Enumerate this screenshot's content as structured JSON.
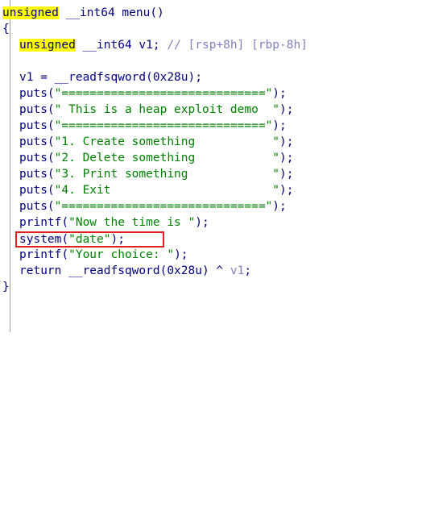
{
  "code": {
    "signature": {
      "kw": "unsigned",
      "rest": " __int64 menu()"
    },
    "open_brace": "{",
    "decl": {
      "kw": "unsigned",
      "rest": " __int64 v1; ",
      "comment": "// [rsp+8h] [rbp-8h]"
    },
    "line_v1": "v1 = __readfsqword(0x28u);",
    "puts_lines": [
      {
        "fn": "puts(",
        "str": "\"=============================\"",
        "end": ");"
      },
      {
        "fn": "puts(",
        "str": "\" This is a heap exploit demo  \"",
        "end": ");"
      },
      {
        "fn": "puts(",
        "str": "\"=============================\"",
        "end": ");"
      },
      {
        "fn": "puts(",
        "str": "\"1. Create something           \"",
        "end": ");"
      },
      {
        "fn": "puts(",
        "str": "\"2. Delete something           \"",
        "end": ");"
      },
      {
        "fn": "puts(",
        "str": "\"3. Print something            \"",
        "end": ");"
      },
      {
        "fn": "puts(",
        "str": "\"4. Exit                       \"",
        "end": ");"
      },
      {
        "fn": "puts(",
        "str": "\"=============================\"",
        "end": ");"
      }
    ],
    "printf_time": {
      "fn": "printf(",
      "str": "\"Now the time is \"",
      "end": ");"
    },
    "system_call": {
      "fn": "system(",
      "str": "\"date\"",
      "end": ");"
    },
    "printf_choice": {
      "fn": "printf(",
      "str": "\"Your choice: \"",
      "end": ");"
    },
    "return_line": {
      "pre": "return __readfsqword(0x28u) ^ ",
      "var": "v1",
      "end": ";"
    },
    "close_brace": "}"
  },
  "colors": {
    "keyword_highlight": "#ffff00",
    "code_text": "#000080",
    "string_literal": "#008000",
    "comment": "#8080c0",
    "annotation_box": "#e02020"
  }
}
